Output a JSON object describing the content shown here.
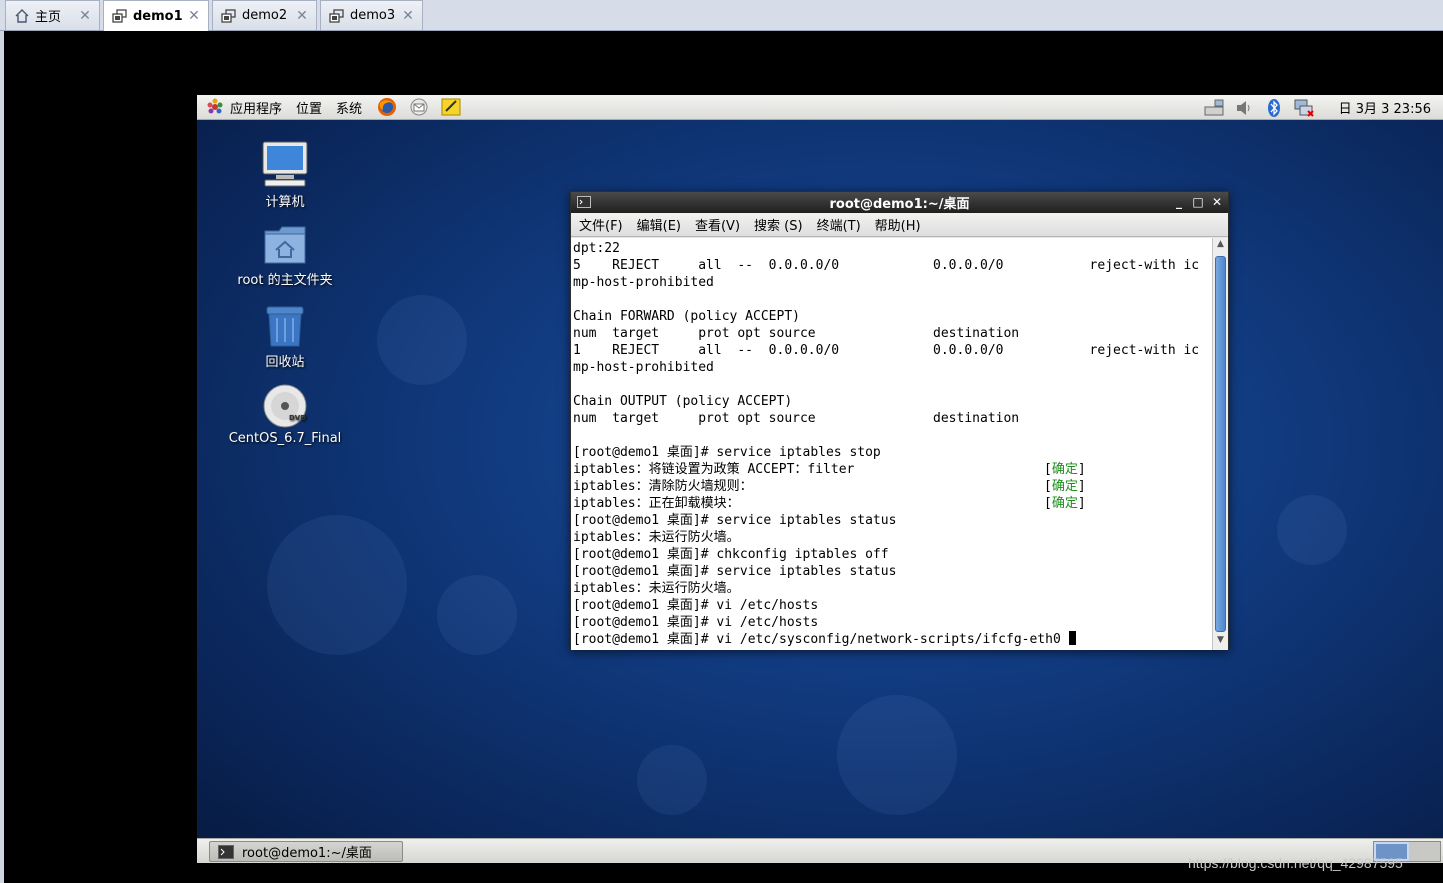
{
  "host_tabs": [
    {
      "label": "主页",
      "icon": "home-icon",
      "active": false
    },
    {
      "label": "demo1",
      "icon": "vm-icon",
      "active": true
    },
    {
      "label": "demo2",
      "icon": "vm-icon",
      "active": false
    },
    {
      "label": "demo3",
      "icon": "vm-icon",
      "active": false
    }
  ],
  "top_panel": {
    "menus": [
      "应用程序",
      "位置",
      "系统"
    ],
    "launchers": [
      "firefox-icon",
      "mail-icon",
      "notes-icon"
    ],
    "tray": [
      "network-icon",
      "volume-icon",
      "bluetooth-icon",
      "network-disconnected-icon"
    ],
    "clock": "日 3月  3 23:56"
  },
  "desktop_icons": [
    {
      "label": "计算机",
      "icon": "computer-icon"
    },
    {
      "label": "root 的主文件夹",
      "icon": "home-folder-icon"
    },
    {
      "label": "回收站",
      "icon": "trash-icon"
    },
    {
      "label": "CentOS_6.7_Final",
      "icon": "dvd-icon"
    }
  ],
  "terminal": {
    "title": "root@demo1:~/桌面",
    "menu": [
      "文件(F)",
      "编辑(E)",
      "查看(V)",
      "搜索 (S)",
      "终端(T)",
      "帮助(H)"
    ],
    "lines": [
      "dpt:22",
      "5    REJECT     all  --  0.0.0.0/0            0.0.0.0/0           reject-with ic",
      "mp-host-prohibited",
      "",
      "Chain FORWARD (policy ACCEPT)",
      "num  target     prot opt source               destination",
      "1    REJECT     all  --  0.0.0.0/0            0.0.0.0/0           reject-with ic",
      "mp-host-prohibited",
      "",
      "Chain OUTPUT (policy ACCEPT)",
      "num  target     prot opt source               destination",
      "",
      "[root@demo1 桌面]# service iptables stop",
      "iptables：将链设置为政策 ACCEPT：filter",
      "iptables：清除防火墙规则：",
      "iptables：正在卸载模块：",
      "[root@demo1 桌面]# service iptables status",
      "iptables：未运行防火墙。",
      "[root@demo1 桌面]# chkconfig iptables off",
      "[root@demo1 桌面]# service iptables status",
      "iptables：未运行防火墙。",
      "[root@demo1 桌面]# vi /etc/hosts",
      "[root@demo1 桌面]# vi /etc/hosts",
      "[root@demo1 桌面]# vi /etc/sysconfig/network-scripts/ifcfg-eth0 "
    ],
    "ok_marker": {
      "open": "[",
      "text": "确定",
      "close": "]"
    },
    "ok_lines": [
      13,
      14,
      15
    ]
  },
  "taskbar": {
    "window_button": "root@demo1:~/桌面"
  },
  "watermark": "https://blog.csdn.net/qq_42987595"
}
